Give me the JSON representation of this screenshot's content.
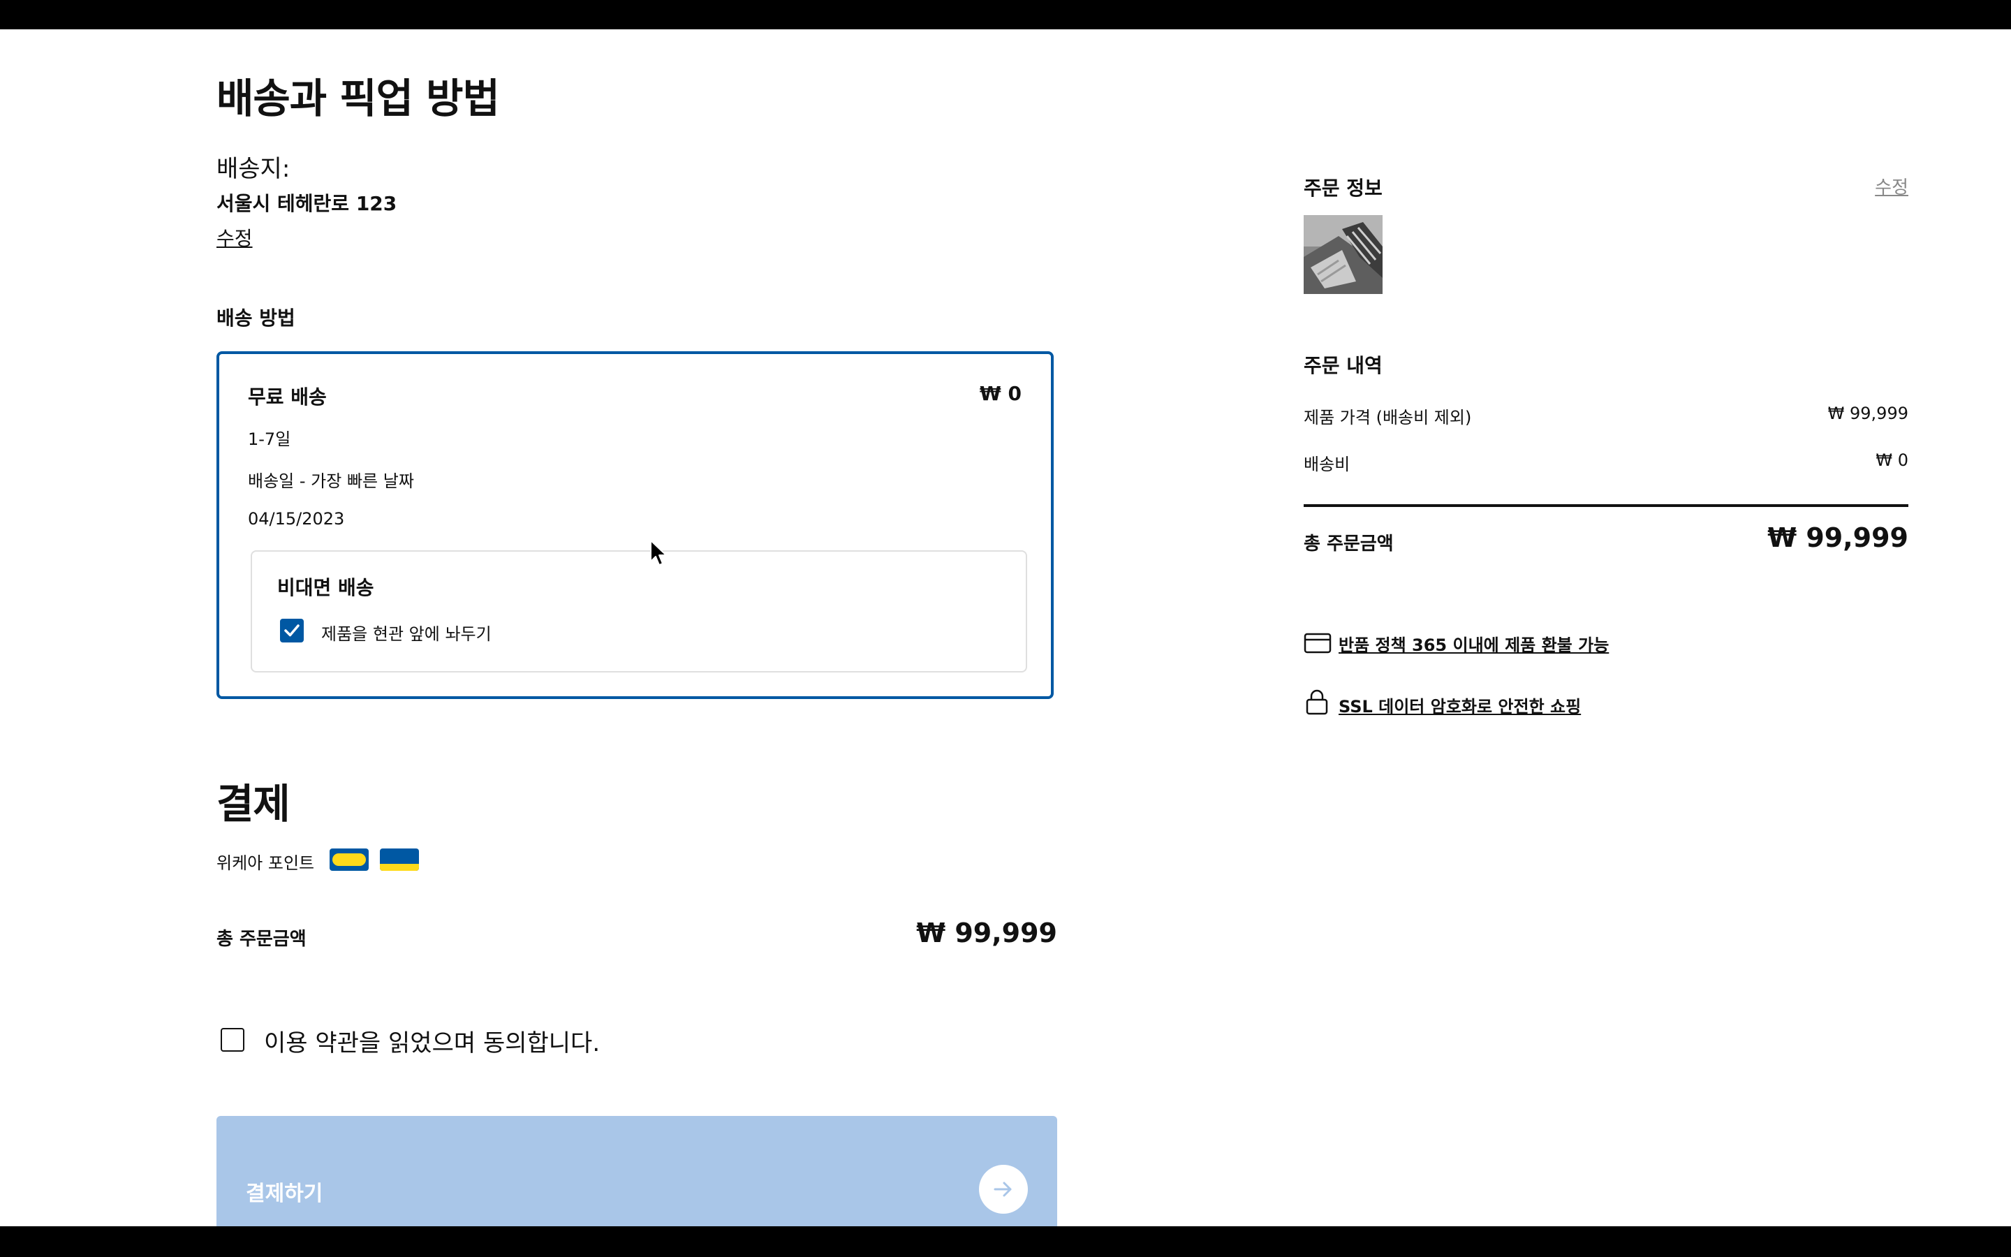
{
  "main": {
    "title": "배송과 픽업 방법",
    "address_label": "배송지:",
    "address_value": "서울시 테헤란로 123",
    "address_edit": "수정",
    "delivery_method_label": "배송 방법",
    "delivery_option": {
      "name": "무료 배송",
      "price": "₩ 0",
      "duration": "1-7일",
      "date_label": "배송일 - 가장 빠른 날짜",
      "date": "04/15/2023"
    },
    "contactless": {
      "title": "비대면 배송",
      "option_label": "제품을 현관 앞에 놔두기",
      "checked": true
    },
    "payment_title": "결제",
    "points_label": "위케아 포인트",
    "card_icons": [
      "wekea-card-icon",
      "family-card-icon"
    ],
    "total_label": "총 주문금액",
    "total_value": "₩ 99,999",
    "terms_label": "이용 약관을 읽었으며 동의합니다.",
    "terms_checked": false,
    "pay_button": "결제하기"
  },
  "summary": {
    "order_info_title": "주문 정보",
    "edit_link": "수정",
    "order_detail_title": "주문 내역",
    "product_price_label": "제품 가격 (배송비 제외)",
    "product_price_value": "₩ 99,999",
    "shipping_label": "배송비",
    "shipping_value": "₩ 0",
    "total_label": "총 주문금액",
    "total_value": "₩ 99,999",
    "return_policy_link": "반품 정책 365 이내에 제품 환불 가능",
    "ssl_link": "SSL 데이터 암호화로 안전한 쇼핑"
  },
  "colors": {
    "accent": "#0058a3",
    "button_disabled": "#a9c6e8",
    "card_yellow": "#ffda1a"
  }
}
